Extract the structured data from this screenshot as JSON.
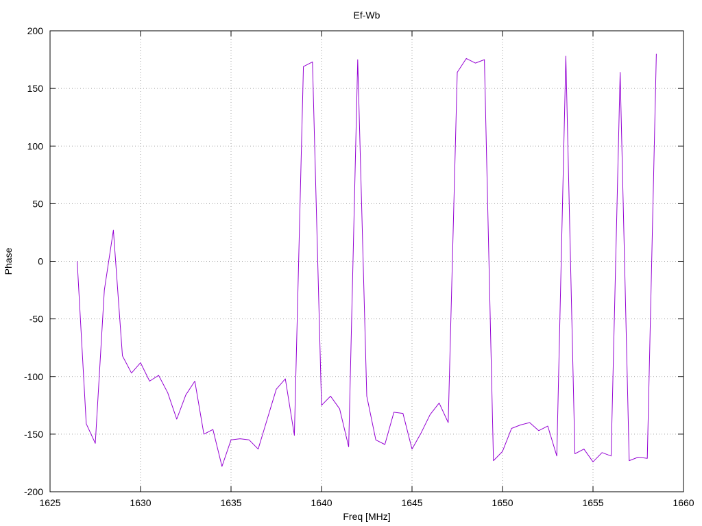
{
  "chart_data": {
    "type": "line",
    "title": "Ef-Wb",
    "xlabel": "Freq [MHz]",
    "ylabel": "Phase",
    "xlim": [
      1625,
      1660
    ],
    "ylim": [
      -200,
      200
    ],
    "xticks": [
      1625,
      1630,
      1635,
      1640,
      1645,
      1650,
      1655,
      1660
    ],
    "yticks": [
      -200,
      -150,
      -100,
      -50,
      0,
      50,
      100,
      150,
      200
    ],
    "grid": true,
    "legend": "none",
    "series": [
      {
        "color": "#9400d3",
        "x": [
          1626.5,
          1627.0,
          1627.5,
          1628.0,
          1628.5,
          1629.0,
          1629.5,
          1630.0,
          1630.5,
          1631.0,
          1631.5,
          1632.0,
          1632.5,
          1633.0,
          1633.5,
          1634.0,
          1634.5,
          1635.0,
          1635.5,
          1636.0,
          1636.5,
          1637.0,
          1637.5,
          1638.0,
          1638.5,
          1639.0,
          1639.5,
          1640.0,
          1640.5,
          1641.0,
          1641.5,
          1642.0,
          1642.5,
          1643.0,
          1643.5,
          1644.0,
          1644.5,
          1645.0,
          1645.5,
          1646.0,
          1646.5,
          1647.0,
          1647.5,
          1648.0,
          1648.5,
          1649.0,
          1649.5,
          1650.0,
          1650.5,
          1651.0,
          1651.5,
          1652.0,
          1652.5,
          1653.0,
          1653.5,
          1654.0,
          1654.5,
          1655.0,
          1655.5,
          1656.0,
          1656.5,
          1657.0,
          1657.5,
          1658.0,
          1658.5
        ],
        "y": [
          0,
          -141,
          -158,
          -25,
          27,
          -82,
          -97,
          -88,
          -104,
          -99,
          -114,
          -137,
          -116,
          -104,
          -150,
          -146,
          -178,
          -155,
          -154,
          -155,
          -163,
          -137,
          -111,
          -102,
          -151,
          169,
          173,
          -125,
          -117,
          -128,
          -161,
          175,
          -117,
          -155,
          -159,
          -131,
          -132,
          -163,
          -149,
          -133,
          -123,
          -140,
          164,
          176,
          172,
          175,
          -173,
          -165,
          -145,
          -142,
          -140,
          -147,
          -143,
          -169,
          178,
          -167,
          -163,
          -174,
          -166,
          -169,
          164,
          -173,
          -170,
          -171,
          180
        ]
      }
    ]
  }
}
